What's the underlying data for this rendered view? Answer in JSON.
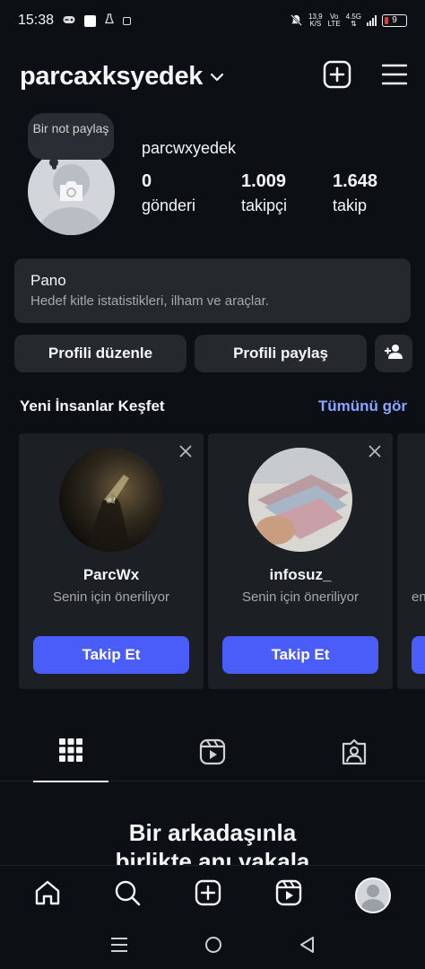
{
  "status": {
    "time": "15:38",
    "net_speed": "13,9",
    "net_unit": "K/S",
    "vo": "Vo",
    "lte": "LTE",
    "gen": "4.5G",
    "battery": "9"
  },
  "header": {
    "username": "parcaxksyedek"
  },
  "profile": {
    "note_text": "Bir not paylaş",
    "handle": "parcwxyedek",
    "stats": [
      {
        "value": "0",
        "label": "gönderi"
      },
      {
        "value": "1.009",
        "label": "takipçi"
      },
      {
        "value": "1.648",
        "label": "takip"
      }
    ]
  },
  "pano": {
    "title": "Pano",
    "subtitle": "Hedef kitle istatistikleri, ilham ve araçlar."
  },
  "actions": {
    "edit": "Profili düzenle",
    "share": "Profili paylaş"
  },
  "suggestions": {
    "title": "Yeni İnsanlar Keşfet",
    "see_all": "Tümünü gör",
    "cards": [
      {
        "name": "ParcWx",
        "sub": "Senin için öneriliyor",
        "follow": "Takip Et"
      },
      {
        "name": "infosuz_",
        "sub": "Senin için öneriliyor",
        "follow": "Takip Et"
      },
      {
        "name": "",
        "sub": "en",
        "follow": ""
      }
    ]
  },
  "empty_state": {
    "title_line1": "Bir arkadaşınla",
    "title_line2": "birlikte anı yakala"
  },
  "colors": {
    "background": "#0c1014",
    "surface": "#25292e",
    "accent": "#4a5df9",
    "link": "#8aa5ff"
  }
}
